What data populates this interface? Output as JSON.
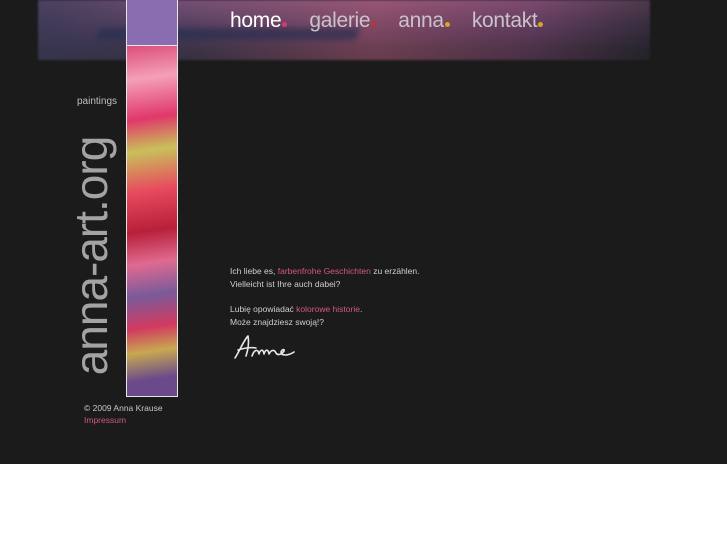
{
  "nav": {
    "items": [
      {
        "label": "home",
        "dot_color": "#d43d72",
        "active": true
      },
      {
        "label": "galerie",
        "dot_color": "#c0303a",
        "active": false
      },
      {
        "label": "anna",
        "dot_color": "#d4a62a",
        "active": false
      },
      {
        "label": "kontakt",
        "dot_color": "#d4a62a",
        "active": false
      }
    ]
  },
  "logo": {
    "tagline": "paintings",
    "site_name": "anna-art.org"
  },
  "intro": {
    "de": {
      "prefix": "Ich liebe es, ",
      "link": "farbenfrohe Geschichten",
      "suffix": " zu erzählen.",
      "line2": "Vielleicht ist Ihre auch dabei?"
    },
    "pl": {
      "prefix": "Lubię opowiadać ",
      "link": "kolorowe historie",
      "suffix": ".",
      "line2": "Może znajdziesz swoją!?"
    }
  },
  "footer": {
    "copyright": "© 2009 Anna Krause",
    "impressum": "Impressum"
  },
  "colors": {
    "background": "#1b1b1b",
    "link": "#d2578a",
    "text": "#cfcfcf"
  }
}
